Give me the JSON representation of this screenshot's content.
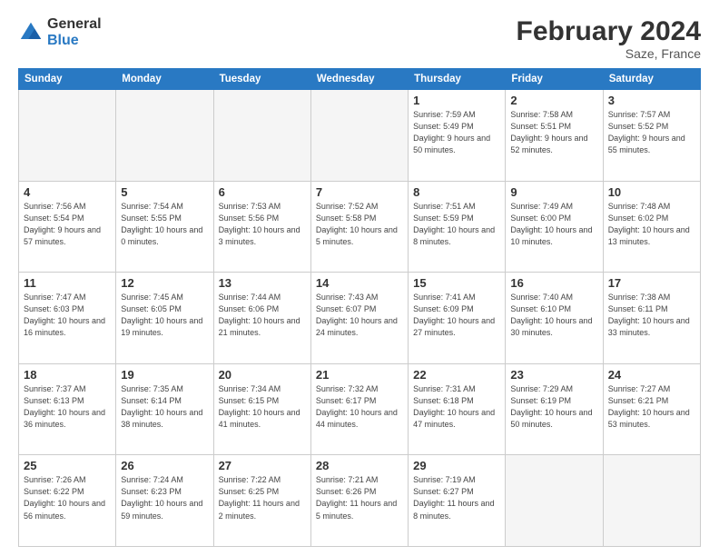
{
  "header": {
    "logo_general": "General",
    "logo_blue": "Blue",
    "title": "February 2024",
    "location": "Saze, France"
  },
  "days_of_week": [
    "Sunday",
    "Monday",
    "Tuesday",
    "Wednesday",
    "Thursday",
    "Friday",
    "Saturday"
  ],
  "weeks": [
    [
      {
        "day": "",
        "empty": true
      },
      {
        "day": "",
        "empty": true
      },
      {
        "day": "",
        "empty": true
      },
      {
        "day": "",
        "empty": true
      },
      {
        "day": "1",
        "sunrise": "7:59 AM",
        "sunset": "5:49 PM",
        "daylight": "9 hours and 50 minutes."
      },
      {
        "day": "2",
        "sunrise": "7:58 AM",
        "sunset": "5:51 PM",
        "daylight": "9 hours and 52 minutes."
      },
      {
        "day": "3",
        "sunrise": "7:57 AM",
        "sunset": "5:52 PM",
        "daylight": "9 hours and 55 minutes."
      }
    ],
    [
      {
        "day": "4",
        "sunrise": "7:56 AM",
        "sunset": "5:54 PM",
        "daylight": "9 hours and 57 minutes."
      },
      {
        "day": "5",
        "sunrise": "7:54 AM",
        "sunset": "5:55 PM",
        "daylight": "10 hours and 0 minutes."
      },
      {
        "day": "6",
        "sunrise": "7:53 AM",
        "sunset": "5:56 PM",
        "daylight": "10 hours and 3 minutes."
      },
      {
        "day": "7",
        "sunrise": "7:52 AM",
        "sunset": "5:58 PM",
        "daylight": "10 hours and 5 minutes."
      },
      {
        "day": "8",
        "sunrise": "7:51 AM",
        "sunset": "5:59 PM",
        "daylight": "10 hours and 8 minutes."
      },
      {
        "day": "9",
        "sunrise": "7:49 AM",
        "sunset": "6:00 PM",
        "daylight": "10 hours and 10 minutes."
      },
      {
        "day": "10",
        "sunrise": "7:48 AM",
        "sunset": "6:02 PM",
        "daylight": "10 hours and 13 minutes."
      }
    ],
    [
      {
        "day": "11",
        "sunrise": "7:47 AM",
        "sunset": "6:03 PM",
        "daylight": "10 hours and 16 minutes."
      },
      {
        "day": "12",
        "sunrise": "7:45 AM",
        "sunset": "6:05 PM",
        "daylight": "10 hours and 19 minutes."
      },
      {
        "day": "13",
        "sunrise": "7:44 AM",
        "sunset": "6:06 PM",
        "daylight": "10 hours and 21 minutes."
      },
      {
        "day": "14",
        "sunrise": "7:43 AM",
        "sunset": "6:07 PM",
        "daylight": "10 hours and 24 minutes."
      },
      {
        "day": "15",
        "sunrise": "7:41 AM",
        "sunset": "6:09 PM",
        "daylight": "10 hours and 27 minutes."
      },
      {
        "day": "16",
        "sunrise": "7:40 AM",
        "sunset": "6:10 PM",
        "daylight": "10 hours and 30 minutes."
      },
      {
        "day": "17",
        "sunrise": "7:38 AM",
        "sunset": "6:11 PM",
        "daylight": "10 hours and 33 minutes."
      }
    ],
    [
      {
        "day": "18",
        "sunrise": "7:37 AM",
        "sunset": "6:13 PM",
        "daylight": "10 hours and 36 minutes."
      },
      {
        "day": "19",
        "sunrise": "7:35 AM",
        "sunset": "6:14 PM",
        "daylight": "10 hours and 38 minutes."
      },
      {
        "day": "20",
        "sunrise": "7:34 AM",
        "sunset": "6:15 PM",
        "daylight": "10 hours and 41 minutes."
      },
      {
        "day": "21",
        "sunrise": "7:32 AM",
        "sunset": "6:17 PM",
        "daylight": "10 hours and 44 minutes."
      },
      {
        "day": "22",
        "sunrise": "7:31 AM",
        "sunset": "6:18 PM",
        "daylight": "10 hours and 47 minutes."
      },
      {
        "day": "23",
        "sunrise": "7:29 AM",
        "sunset": "6:19 PM",
        "daylight": "10 hours and 50 minutes."
      },
      {
        "day": "24",
        "sunrise": "7:27 AM",
        "sunset": "6:21 PM",
        "daylight": "10 hours and 53 minutes."
      }
    ],
    [
      {
        "day": "25",
        "sunrise": "7:26 AM",
        "sunset": "6:22 PM",
        "daylight": "10 hours and 56 minutes."
      },
      {
        "day": "26",
        "sunrise": "7:24 AM",
        "sunset": "6:23 PM",
        "daylight": "10 hours and 59 minutes."
      },
      {
        "day": "27",
        "sunrise": "7:22 AM",
        "sunset": "6:25 PM",
        "daylight": "11 hours and 2 minutes."
      },
      {
        "day": "28",
        "sunrise": "7:21 AM",
        "sunset": "6:26 PM",
        "daylight": "11 hours and 5 minutes."
      },
      {
        "day": "29",
        "sunrise": "7:19 AM",
        "sunset": "6:27 PM",
        "daylight": "11 hours and 8 minutes."
      },
      {
        "day": "",
        "empty": true
      },
      {
        "day": "",
        "empty": true
      }
    ]
  ]
}
